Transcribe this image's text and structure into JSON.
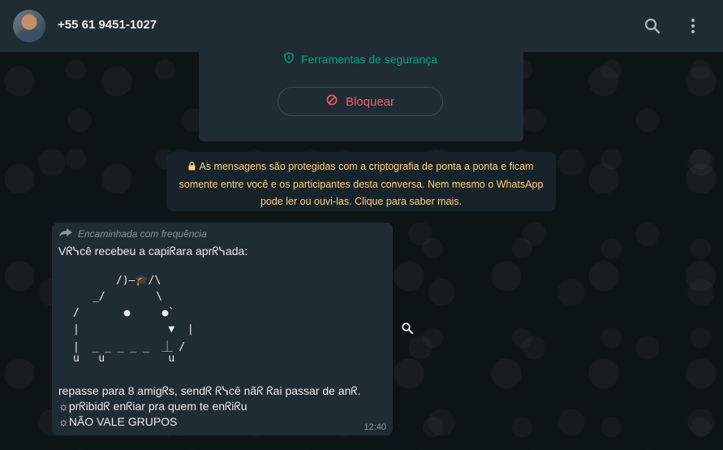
{
  "header": {
    "contact_name": "+55 61 9451-1027"
  },
  "info_card": {
    "security_tools": "Ferramentas de segurança",
    "block_label": "Bloquear"
  },
  "encryption_notice": {
    "line1": "As mensagens são protegidas com a criptografia de ponta a ponta e ficam",
    "line2": "somente entre você e os participantes desta conversa. Nem mesmo o WhatsApp",
    "line3": "pode ler ou ouvi-las. Clique para saber mais."
  },
  "message": {
    "forwarded_label": "Encaminhada com frequência",
    "line1": "Vᖇᓭcê recebeu a capiᖇara aprᖇᓭada:",
    "art": {
      "r1": "/)–🎓/\\",
      "r2": "_/        \\",
      "r3": "/       ●     ●`",
      "r4": "|              ▼  |",
      "r5": "|  _ _ _ _ _  ⏊ /",
      "r6": "u   u          u"
    },
    "line2": "repasse para 8 amigᖇs, sendᖇ ᖇᓭcê nãᖇ ᖇai passar de anᖇ.",
    "line3": "☼prᖇibidᖇ enᖇiar pra quem te enᖇiᖇu",
    "line4": "☼NÃO VALE GRUPOS",
    "time": "12:40"
  },
  "colors": {
    "header_bg": "#202c33",
    "accent_green": "#00a884",
    "danger_red": "#f15c6d",
    "notice_yellow": "#ffd279",
    "bubble_bg": "#202c33"
  },
  "icons": {
    "search": "search-icon",
    "menu": "kebab-menu-icon",
    "shield": "shield-icon",
    "block": "block-icon",
    "lock": "lock-icon",
    "forward": "forward-icon",
    "zoom": "zoom-icon"
  }
}
